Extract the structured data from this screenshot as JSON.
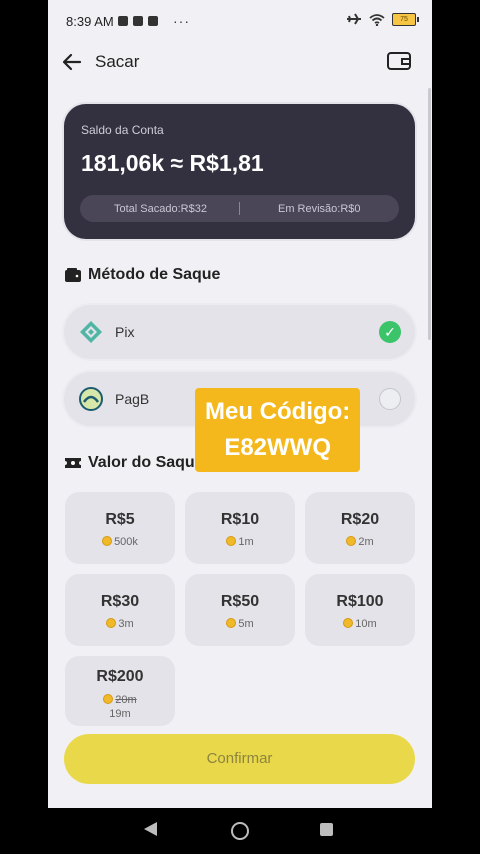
{
  "status_bar": {
    "time": "8:39 AM",
    "dots": "···",
    "battery": "75"
  },
  "header": {
    "title": "Sacar"
  },
  "balance": {
    "label": "Saldo da Conta",
    "amount": "181,06k ≈ R$1,81",
    "total_withdrawn": "Total Sacado:R$32",
    "under_review": "Em Revisão:R$0"
  },
  "method_section": {
    "title": "Método de Saque",
    "methods": [
      {
        "label": "Pix",
        "selected": true
      },
      {
        "label": "PagB",
        "selected": false
      }
    ]
  },
  "overlay": {
    "line1": "Meu Código:",
    "line2": "E82WWQ"
  },
  "amount_section": {
    "title": "Valor do Saque",
    "options": [
      {
        "value": "R$5",
        "coins": "500k"
      },
      {
        "value": "R$10",
        "coins": "1m"
      },
      {
        "value": "R$20",
        "coins": "2m"
      },
      {
        "value": "R$30",
        "coins": "3m"
      },
      {
        "value": "R$50",
        "coins": "5m"
      },
      {
        "value": "R$100",
        "coins": "10m"
      },
      {
        "value": "R$200",
        "coins": "20m",
        "discount_coins": "19m"
      }
    ]
  },
  "confirm_label": "Confirmar",
  "colors": {
    "accent_yellow": "#e9d94a",
    "card_dark": "#33303f",
    "check_green": "#3bc46a",
    "overlay_orange": "#f4b81c"
  }
}
